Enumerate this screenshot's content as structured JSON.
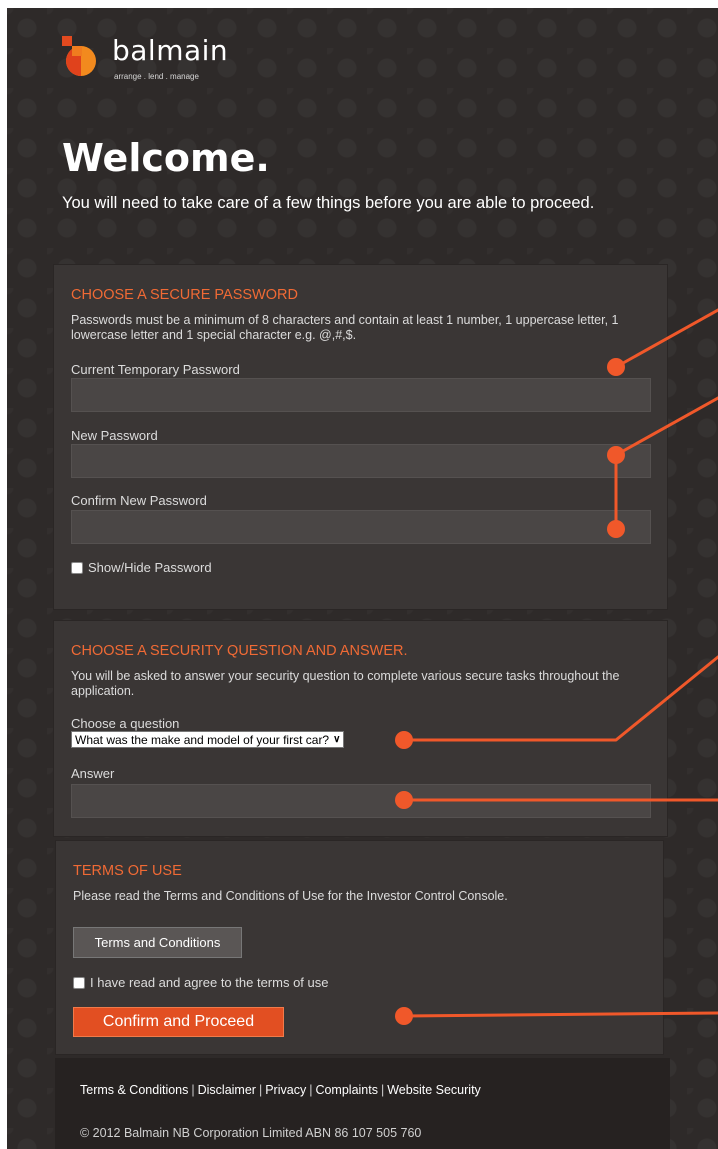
{
  "brand": {
    "name": "balmain",
    "tagline": "arrange . lend . manage"
  },
  "welcome": {
    "title": "Welcome.",
    "subtitle": "You will need to take care of a few things before you are able to proceed."
  },
  "password_section": {
    "heading": "CHOOSE A SECURE PASSWORD",
    "description": "Passwords must be a minimum of 8 characters and contain at least 1 number, 1 uppercase letter, 1 lowercase letter and 1 special character e.g. @,#,$.",
    "current_label": "Current Temporary Password",
    "current_value": "",
    "new_label": "New Password",
    "new_value": "",
    "confirm_label": "Confirm New Password",
    "confirm_value": "",
    "show_hide_label": "Show/Hide Password",
    "show_hide_checked": false
  },
  "security_section": {
    "heading": "CHOOSE A SECURITY QUESTION AND ANSWER.",
    "description": "You will be asked to answer your security question to complete various secure tasks throughout the application.",
    "question_label": "Choose a question",
    "question_selected": "What was the make and model of your first car?",
    "answer_label": "Answer",
    "answer_value": ""
  },
  "terms_section": {
    "heading": "TERMS OF USE",
    "description": "Please read the Terms and Conditions of Use for the Investor Control Console.",
    "terms_button": "Terms and Conditions",
    "agree_label": "I have read and agree to the terms of use",
    "agree_checked": false,
    "confirm_button": "Confirm and Proceed"
  },
  "footer": {
    "links": [
      "Terms & Conditions",
      "Disclaimer",
      "Privacy",
      "Complaints",
      "Website Security"
    ],
    "separator": "|",
    "copyright": "© 2012 Balmain NB Corporation Limited   ABN 86 107 505 760"
  },
  "colors": {
    "accent": "#e24f22",
    "annotation": "#f0582a",
    "background": "#2e2a29",
    "panel": "#3a3635"
  }
}
